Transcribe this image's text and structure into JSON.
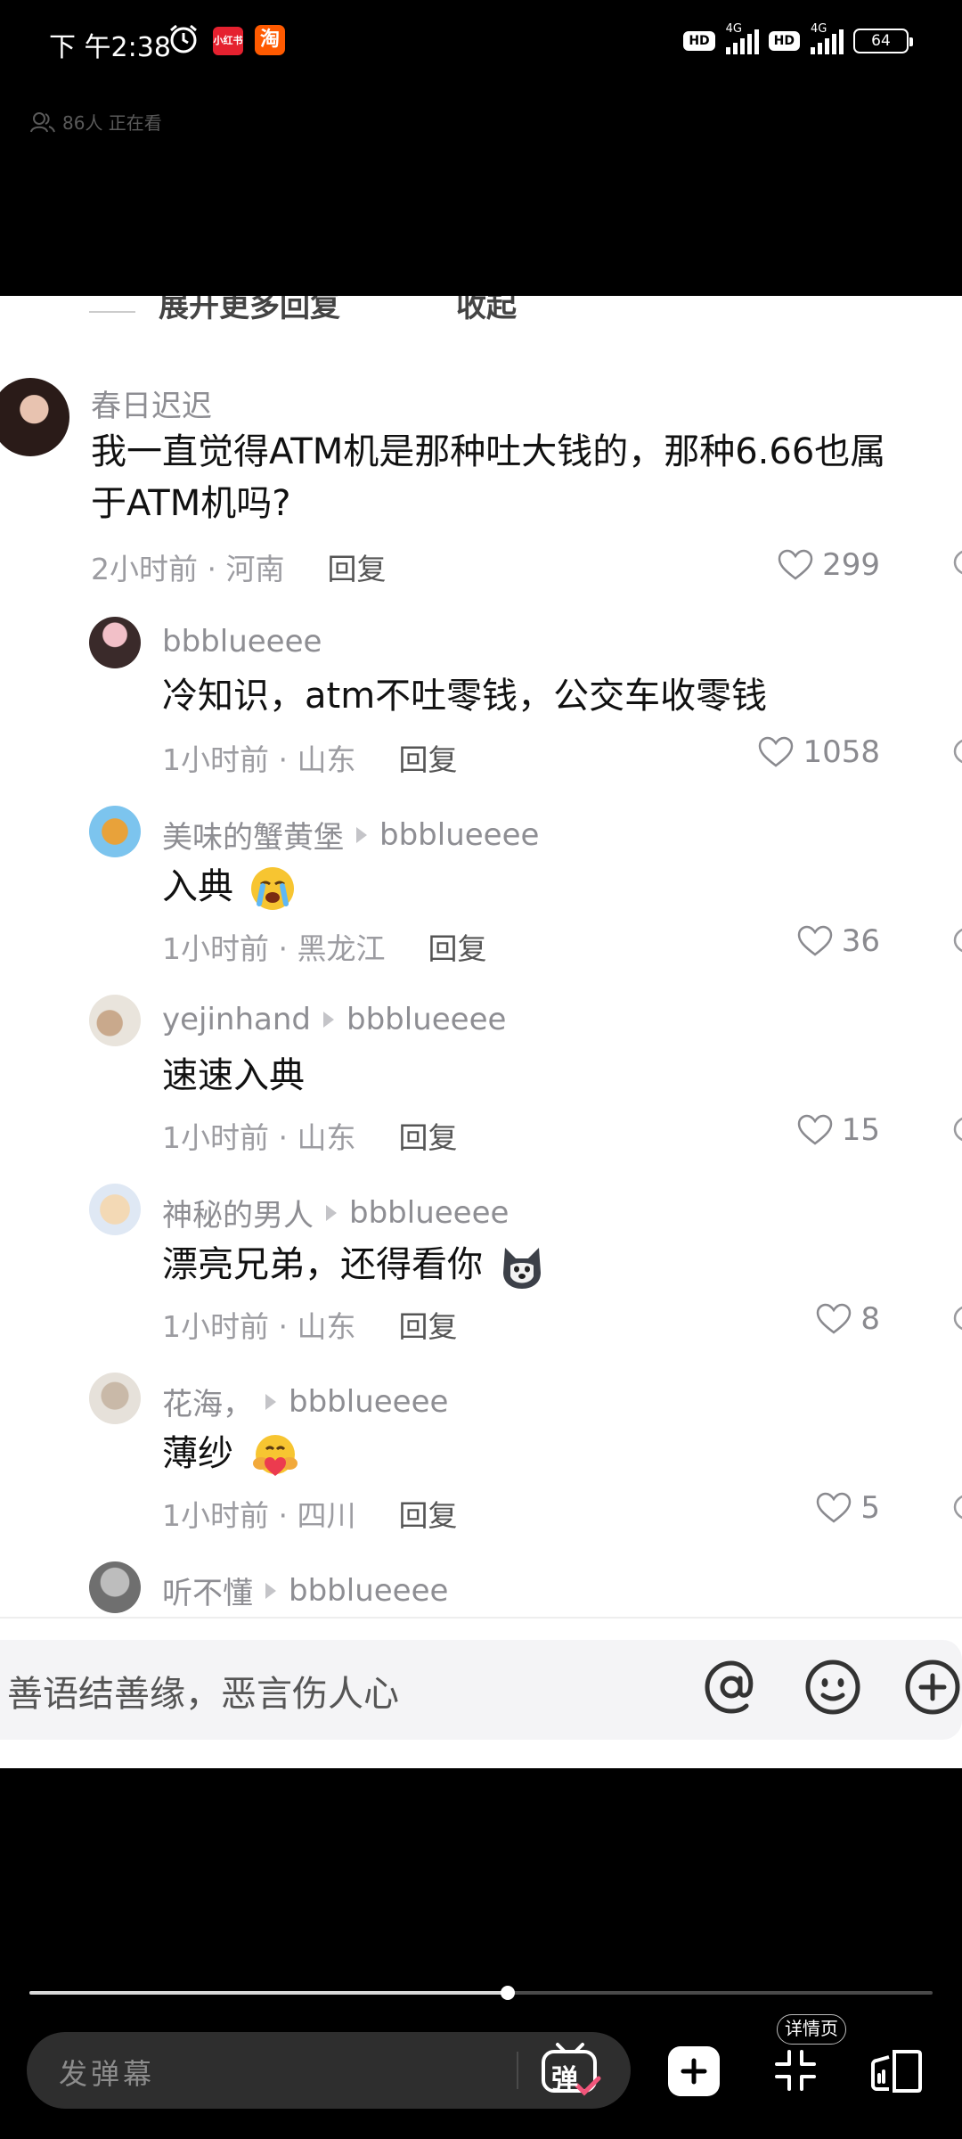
{
  "status_bar": {
    "time": "下 午2:38",
    "app_badge_1": "小红书",
    "app_badge_2": "淘",
    "hd_1": "HD",
    "hd_2": "HD",
    "net_1": "4G",
    "net_2": "4G",
    "battery": "64"
  },
  "viewers": {
    "text": "86人 正在看"
  },
  "clipped_header": {
    "expand_label": "展开更多回复",
    "collapse_label": "收起"
  },
  "comments": [
    {
      "user": "春日迟迟",
      "text_line1": "我一直觉得ATM机是那种吐大钱的，那种6.66也属",
      "text_line2": "于ATM机吗?",
      "meta": "2小时前 · 河南",
      "reply_label": "回复",
      "likes": "299"
    }
  ],
  "replies": [
    {
      "user": "bbblueeee",
      "reply_to": "",
      "text": "冷知识，atm不吐零钱，公交车收零钱",
      "meta": "1小时前 · 山东",
      "reply_label": "回复",
      "likes": "1058",
      "emoji": ""
    },
    {
      "user": "美味的蟹黄堡",
      "reply_to": "bbblueeee",
      "text": "入典",
      "meta": "1小时前 · 黑龙江",
      "reply_label": "回复",
      "likes": "36",
      "emoji": "crying-face"
    },
    {
      "user": "yejinhand",
      "reply_to": "bbblueeee",
      "text": "速速入典",
      "meta": "1小时前 · 山东",
      "reply_label": "回复",
      "likes": "15",
      "emoji": ""
    },
    {
      "user": "神秘的男人",
      "reply_to": "bbblueeee",
      "text": "漂亮兄弟，还得看你",
      "meta": "1小时前 · 山东",
      "reply_label": "回复",
      "likes": "8",
      "emoji": "husky-face"
    },
    {
      "user": "花海，",
      "reply_to": "bbblueeee",
      "text": "薄纱",
      "meta": "1小时前 · 四川",
      "reply_label": "回复",
      "likes": "5",
      "emoji": "heart-hug-face"
    },
    {
      "user": "听不懂",
      "reply_to": "bbblueeee",
      "text": "",
      "meta": "",
      "reply_label": "",
      "likes": "",
      "emoji": ""
    }
  ],
  "input": {
    "placeholder": "善语结善缘，恶言伤人心",
    "icons": [
      "at-icon",
      "emoji-icon",
      "plus-icon"
    ]
  },
  "player": {
    "progress": 0.53,
    "danmaku_placeholder": "发弹幕",
    "danmaku_toggle": "弹",
    "detail_tip": "详情页"
  },
  "colors": {
    "text": "#111111",
    "secondary": "#8e8e93",
    "panel": "#ffffff",
    "background": "#000000"
  }
}
